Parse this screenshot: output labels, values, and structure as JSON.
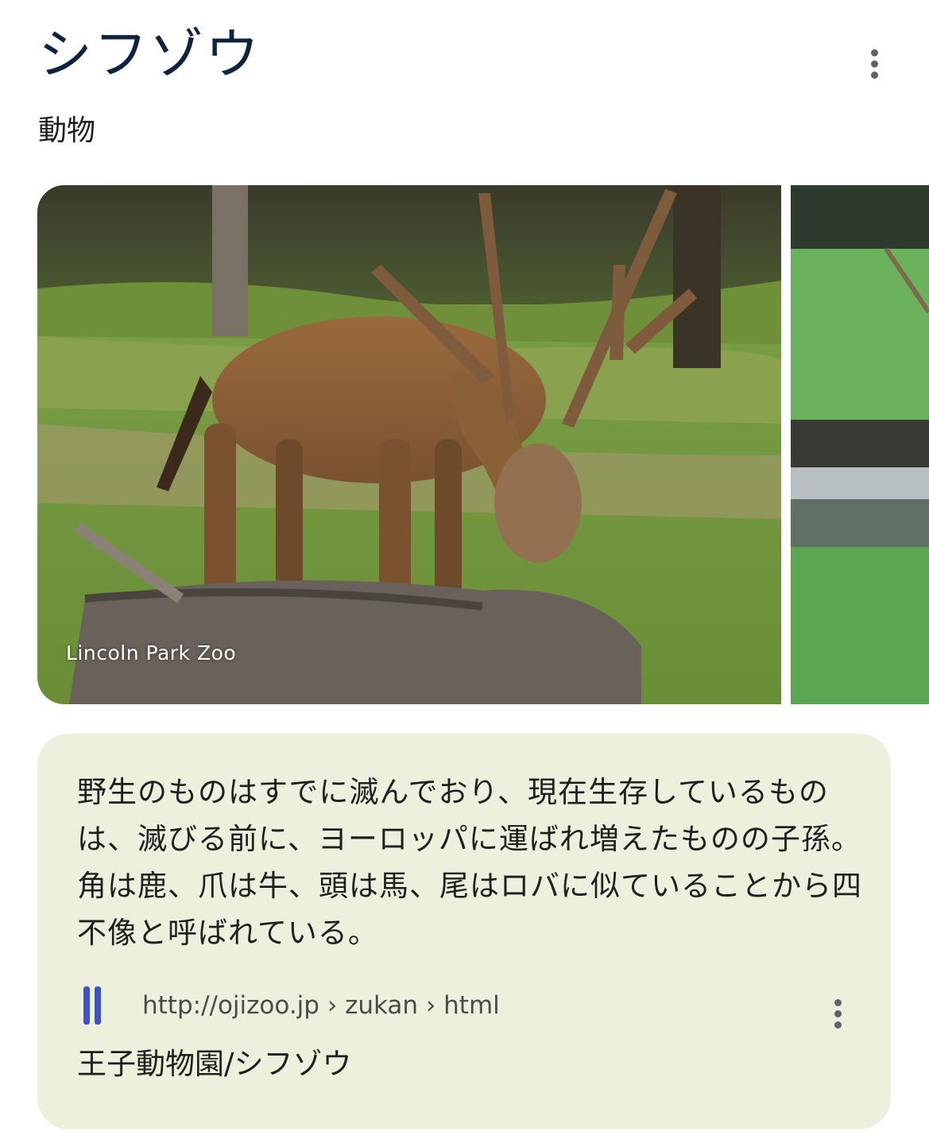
{
  "header": {
    "title": "シフゾウ",
    "subtitle": "動物",
    "menu_icon": "more-vert-icon"
  },
  "images": {
    "main_credit": "Lincoln Park Zoo",
    "main_subject": "deer-photo",
    "side_subject": "pond-meadow-photo"
  },
  "description_card": {
    "text": "野生のものはすでに滅んでおり、現在生存しているものは、滅びる前に、ヨーロッパに運ばれ増えたものの子孫。 角は鹿、爪は牛、頭は馬、尾はロバに似ていることから四不像と呼ばれている。",
    "source_url": "http://ojizoo.jp › zukan › html",
    "source_title": "王子動物園/シフゾウ",
    "favicon_color": "#3f51c9",
    "background": "#eef0de"
  }
}
